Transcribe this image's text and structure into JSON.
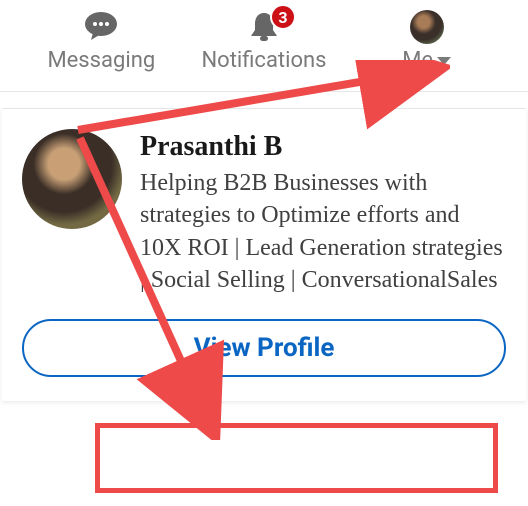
{
  "nav": {
    "messaging": {
      "label": "Messaging"
    },
    "notifications": {
      "label": "Notifications",
      "badge": "3"
    },
    "me": {
      "label": "Me"
    }
  },
  "profile": {
    "name": "Prasanthi B",
    "headline": "Helping B2B Businesses with strategies to Optimize efforts and 10X ROI | Lead Generation strategies | Social Selling | ConversationalSales"
  },
  "actions": {
    "view_profile": "View Profile"
  },
  "colors": {
    "primary": "#0a66c2",
    "badge": "#cc1016",
    "annotation": "#ee4a49"
  }
}
